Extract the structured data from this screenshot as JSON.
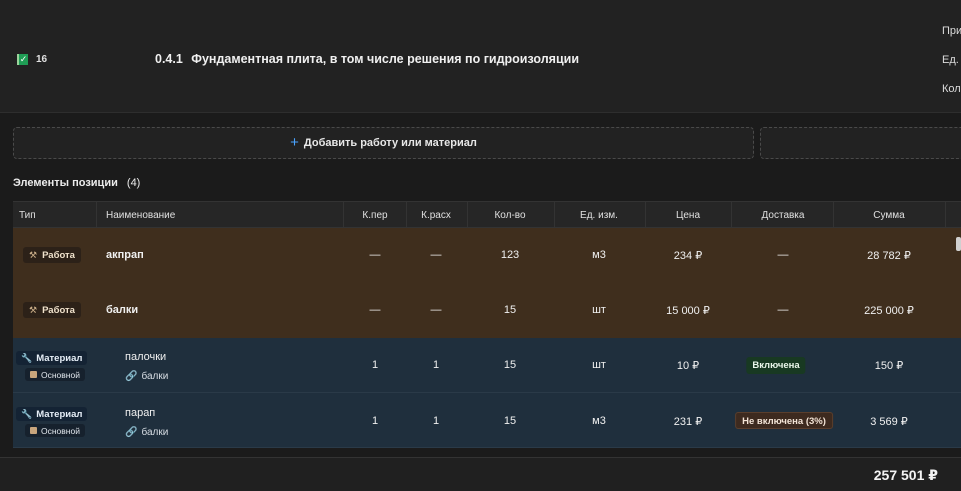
{
  "header": {
    "counter": "16",
    "code": "0.4.1",
    "title": "Фундаментная плита, в том числе решения по гидроизоляции",
    "side_labels": [
      "При",
      "Ед.",
      "Кол"
    ]
  },
  "actions": {
    "add_label": "Добавить работу или материал"
  },
  "section": {
    "title": "Элементы позиции",
    "count": "(4)"
  },
  "table": {
    "columns": {
      "type": "Тип",
      "name": "Наименование",
      "kper": "К.пер",
      "krash": "К.расх",
      "qty": "Кол-во",
      "unit": "Ед. изм.",
      "price": "Цена",
      "delivery": "Доставка",
      "sum": "Сумма"
    },
    "rows": [
      {
        "type": "Работа",
        "name": "акпрап",
        "kper": "—",
        "krash": "—",
        "qty": "123",
        "unit": "м3",
        "price": "234 ₽",
        "delivery": "—",
        "sum": "28 782 ₽"
      },
      {
        "type": "Работа",
        "name": "балки",
        "kper": "—",
        "krash": "—",
        "qty": "15",
        "unit": "шт",
        "price": "15 000 ₽",
        "delivery": "—",
        "sum": "225 000 ₽"
      },
      {
        "type": "Материал",
        "subtype": "Основной",
        "name": "палочки",
        "link": "балки",
        "kper": "1",
        "krash": "1",
        "qty": "15",
        "unit": "шт",
        "price": "10 ₽",
        "delivery": "Включена",
        "sum": "150 ₽"
      },
      {
        "type": "Материал",
        "subtype": "Основной",
        "name": "парап",
        "link": "балки",
        "kper": "1",
        "krash": "1",
        "qty": "15",
        "unit": "м3",
        "price": "231 ₽",
        "delivery": "Не включена (3%)",
        "sum": "3 569 ₽"
      }
    ]
  },
  "footer": {
    "total": "257 501 ₽"
  },
  "colors": {
    "work_row": "#3f2e1d",
    "material_row": "#1f2f3d",
    "accent": "#4aa3ff",
    "included": "#183922",
    "not_included": "#3d2a1f"
  }
}
